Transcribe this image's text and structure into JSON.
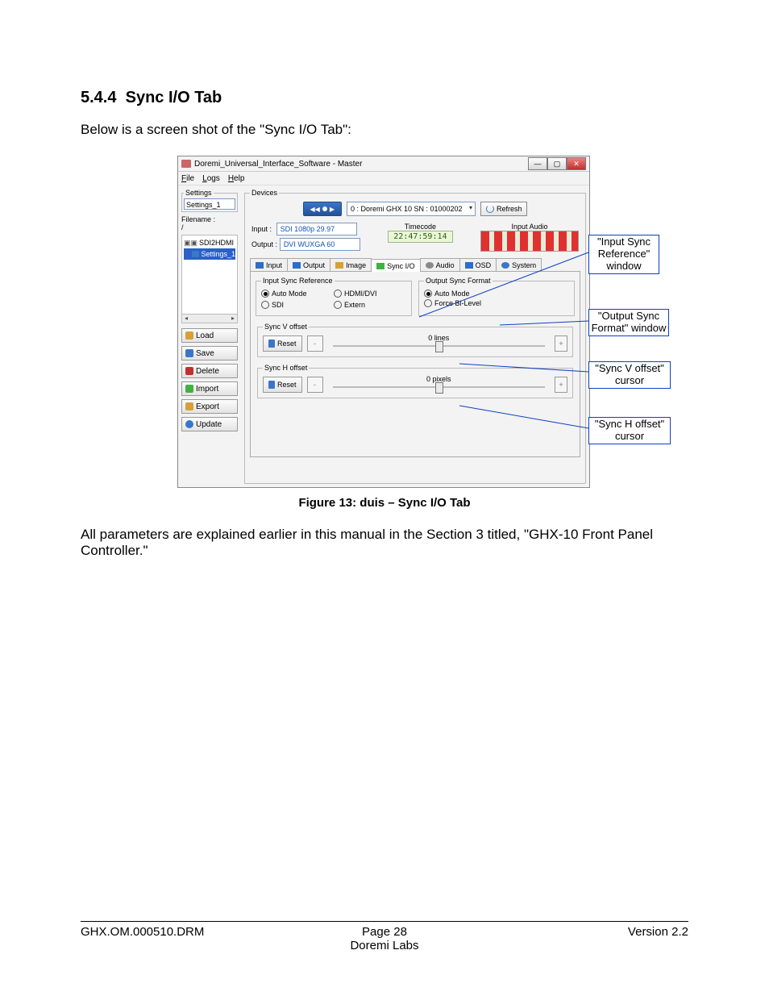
{
  "section": {
    "number": "5.4.4",
    "title": "Sync I/O Tab"
  },
  "intro": "Below is a screen shot of the \"Sync I/O Tab\":",
  "app": {
    "title": "Doremi_Universal_Interface_Software - Master",
    "menus": {
      "file": "File",
      "logs": "Logs",
      "help": "Help"
    },
    "settings": {
      "group": "Settings",
      "settings_input": "Settings_1",
      "filename_label": "Filename :",
      "filename_value": "/",
      "tree": {
        "root": "SDI2HDMI",
        "item": "Settings_1"
      },
      "buttons": {
        "load": "Load",
        "save": "Save",
        "delete": "Delete",
        "import": "Import",
        "export": "Export",
        "update": "Update"
      }
    },
    "devices": {
      "group": "Devices",
      "device_option": "0 : Doremi GHX 10 SN : 01000202",
      "refresh": "Refresh",
      "input_label": "Input :",
      "input_value": "SDI 1080p 29.97",
      "output_label": "Output :",
      "output_value": "DVI WUXGA 60",
      "timecode_label": "Timecode",
      "timecode_value": "22:47:59:14",
      "audio_label": "Input Audio",
      "tabs": {
        "input": "Input",
        "output": "Output",
        "image": "Image",
        "syncio": "Sync I/O",
        "audio": "Audio",
        "osd": "OSD",
        "system": "System"
      },
      "input_sync_ref": {
        "legend": "Input Sync Reference",
        "auto": "Auto Mode",
        "sdi": "SDI",
        "hdmidvi": "HDMI/DVI",
        "extern": "Extern"
      },
      "output_sync_fmt": {
        "legend": "Output Sync Format",
        "auto": "Auto Mode",
        "force": "Force Bi-Level"
      },
      "sync_v": {
        "legend": "Sync V offset",
        "reset": "Reset",
        "value": "0 lines"
      },
      "sync_h": {
        "legend": "Sync H offset",
        "reset": "Reset",
        "value": "0 pixels"
      }
    }
  },
  "callouts": {
    "c1": "\"Input Sync Reference\" window",
    "c2": "\"Output Sync Format\" window",
    "c3": "\"Sync V offset\" cursor",
    "c4": "\"Sync H offset\" cursor"
  },
  "figure_caption": "Figure 13: duis – Sync I/O Tab",
  "outro": "All parameters are explained earlier in this manual in the Section 3  titled, \"GHX-10 Front Panel Controller.\"",
  "footer": {
    "left": "GHX.OM.000510.DRM",
    "center_line1": "Page 28",
    "center_line2": "Doremi Labs",
    "right": "Version 2.2"
  }
}
